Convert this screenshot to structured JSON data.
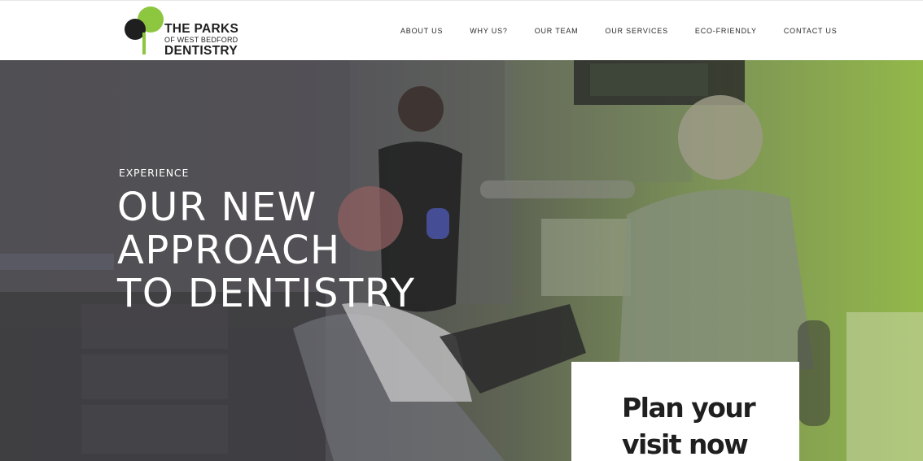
{
  "brand": {
    "line1": "THE PARKS",
    "line2": "OF WEST BEDFORD",
    "line3": "DENTISTRY",
    "logo_icon": "tree-logo-icon",
    "colors": {
      "green": "#8dc63f",
      "dark": "#1f1f1f"
    }
  },
  "nav": {
    "items": [
      {
        "label": "ABOUT US"
      },
      {
        "label": "WHY US?"
      },
      {
        "label": "OUR TEAM"
      },
      {
        "label": "OUR SERVICES"
      },
      {
        "label": "ECO-FRIENDLY"
      },
      {
        "label": "CONTACT US"
      }
    ]
  },
  "hero": {
    "eyebrow": "EXPERIENCE",
    "title_lines": [
      "OUR NEW",
      "APPROACH",
      "TO DENTISTRY"
    ],
    "gradient": {
      "left": "#4b4a4e",
      "right": "#93b84a"
    }
  },
  "cta": {
    "lines": [
      "Plan your",
      "visit now"
    ]
  }
}
